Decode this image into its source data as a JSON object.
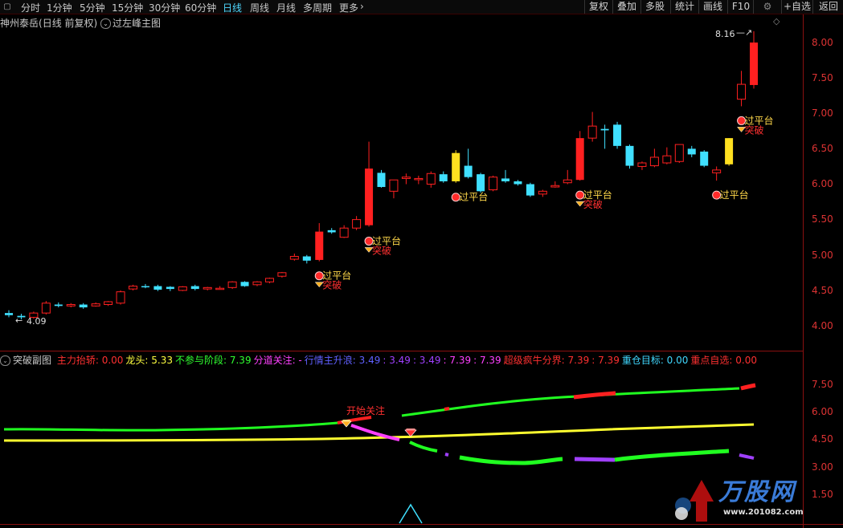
{
  "toolbar": {
    "periods": [
      "分时",
      "1分钟",
      "5分钟",
      "15分钟",
      "30分钟",
      "60分钟",
      "日线",
      "周线",
      "月线",
      "多周期",
      "更多"
    ],
    "active_period": "日线",
    "right_buttons": [
      "复权",
      "叠加",
      "多股",
      "统计",
      "画线",
      "F10",
      "+自选",
      "返回"
    ]
  },
  "main": {
    "stock_name": "神州泰岳",
    "period_info": "(日线 前复权)",
    "indicator": "过左峰主图",
    "high_label": "8.16",
    "low_label": "4.09",
    "y_ticks": [
      "8.00",
      "7.50",
      "7.00",
      "6.50",
      "6.00",
      "5.50",
      "5.00",
      "4.50",
      "4.00"
    ],
    "annotation_platform": "过平台",
    "annotation_break": "突破"
  },
  "sub": {
    "title": "突破副图",
    "legend": [
      {
        "label": "主力抬轿:",
        "value": "0.00",
        "color": "#ff3030"
      },
      {
        "label": "龙头:",
        "value": "5.33",
        "color": "#ffff40"
      },
      {
        "label": "不参与阶段:",
        "value": "7.39",
        "color": "#30ff30"
      },
      {
        "label": "分道关注:",
        "value": "-",
        "color": "#ff40ff"
      },
      {
        "label": "行情主升浪:",
        "value": "3.49",
        "color": "#6060ff"
      },
      {
        "label": ":",
        "value": "3.49",
        "color": "#a040ff"
      },
      {
        "label": ":",
        "value": "3.49",
        "color": "#a040ff"
      },
      {
        "label": ":",
        "value": "7.39",
        "color": "#ff40ff"
      },
      {
        "label": ":",
        "value": "7.39",
        "color": "#ff40ff"
      },
      {
        "label": "超级疯牛分界:",
        "value": "7.39",
        "color": "#ff3030"
      },
      {
        "label": ":",
        "value": "7.39",
        "color": "#ff3030"
      },
      {
        "label": "重仓目标:",
        "value": "0.00",
        "color": "#40d8ff"
      },
      {
        "label": "重点自选:",
        "value": "0.00",
        "color": "#ff3030"
      }
    ],
    "y_ticks": [
      "7.50",
      "6.00",
      "4.50",
      "3.00",
      "1.50"
    ],
    "annotation": "开始关注"
  },
  "watermark": {
    "brand": "万股网",
    "url": "www.201082.com"
  },
  "colors": {
    "up": "#ff2020",
    "down": "#40e0ff",
    "highlight": "#ffe020",
    "grid": "#8a1010"
  },
  "chart_data": {
    "type": "candlestick",
    "ylim": [
      3.85,
      8.3
    ],
    "candles": [
      {
        "o": 4.18,
        "h": 4.22,
        "l": 4.12,
        "c": 4.15
      },
      {
        "o": 4.14,
        "h": 4.17,
        "l": 4.09,
        "c": 4.12
      },
      {
        "o": 4.12,
        "h": 4.2,
        "l": 4.1,
        "c": 4.18
      },
      {
        "o": 4.18,
        "h": 4.35,
        "l": 4.16,
        "c": 4.32
      },
      {
        "o": 4.3,
        "h": 4.33,
        "l": 4.26,
        "c": 4.28
      },
      {
        "o": 4.28,
        "h": 4.32,
        "l": 4.26,
        "c": 4.3
      },
      {
        "o": 4.3,
        "h": 4.32,
        "l": 4.24,
        "c": 4.26
      },
      {
        "o": 4.28,
        "h": 4.33,
        "l": 4.27,
        "c": 4.31
      },
      {
        "o": 4.3,
        "h": 4.35,
        "l": 4.28,
        "c": 4.34
      },
      {
        "o": 4.32,
        "h": 4.5,
        "l": 4.3,
        "c": 4.48
      },
      {
        "o": 4.52,
        "h": 4.58,
        "l": 4.5,
        "c": 4.56
      },
      {
        "o": 4.56,
        "h": 4.59,
        "l": 4.53,
        "c": 4.55
      },
      {
        "o": 4.56,
        "h": 4.58,
        "l": 4.49,
        "c": 4.51
      },
      {
        "o": 4.55,
        "h": 4.56,
        "l": 4.49,
        "c": 4.52
      },
      {
        "o": 4.5,
        "h": 4.56,
        "l": 4.49,
        "c": 4.55
      },
      {
        "o": 4.56,
        "h": 4.58,
        "l": 4.5,
        "c": 4.52
      },
      {
        "o": 4.52,
        "h": 4.55,
        "l": 4.5,
        "c": 4.54
      },
      {
        "o": 4.52,
        "h": 4.56,
        "l": 4.51,
        "c": 4.53
      },
      {
        "o": 4.54,
        "h": 4.63,
        "l": 4.52,
        "c": 4.62
      },
      {
        "o": 4.62,
        "h": 4.63,
        "l": 4.55,
        "c": 4.56
      },
      {
        "o": 4.58,
        "h": 4.63,
        "l": 4.56,
        "c": 4.62
      },
      {
        "o": 4.62,
        "h": 4.68,
        "l": 4.6,
        "c": 4.67
      },
      {
        "o": 4.7,
        "h": 4.76,
        "l": 4.68,
        "c": 4.75
      },
      {
        "o": 4.94,
        "h": 5.02,
        "l": 4.92,
        "c": 4.98
      },
      {
        "o": 4.98,
        "h": 5.0,
        "l": 4.88,
        "c": 4.92
      },
      {
        "o": 4.93,
        "h": 5.45,
        "l": 4.91,
        "c": 5.33
      },
      {
        "o": 5.35,
        "h": 5.38,
        "l": 5.3,
        "c": 5.32
      },
      {
        "o": 5.25,
        "h": 5.42,
        "l": 5.24,
        "c": 5.38
      },
      {
        "o": 5.38,
        "h": 5.55,
        "l": 5.35,
        "c": 5.5
      },
      {
        "o": 5.42,
        "h": 6.6,
        "l": 5.4,
        "c": 6.22
      },
      {
        "o": 6.16,
        "h": 6.2,
        "l": 5.95,
        "c": 5.96
      },
      {
        "o": 5.9,
        "h": 6.05,
        "l": 5.8,
        "c": 6.06
      },
      {
        "o": 6.08,
        "h": 6.15,
        "l": 6.0,
        "c": 6.1
      },
      {
        "o": 6.07,
        "h": 6.12,
        "l": 6.0,
        "c": 6.08
      },
      {
        "o": 6.0,
        "h": 6.18,
        "l": 5.95,
        "c": 6.15
      },
      {
        "o": 6.14,
        "h": 6.18,
        "l": 6.02,
        "c": 6.04
      },
      {
        "o": 6.04,
        "h": 6.48,
        "l": 6.02,
        "c": 6.44
      },
      {
        "o": 6.26,
        "h": 6.5,
        "l": 6.08,
        "c": 6.1
      },
      {
        "o": 6.14,
        "h": 6.16,
        "l": 5.88,
        "c": 5.9
      },
      {
        "o": 5.92,
        "h": 6.12,
        "l": 5.9,
        "c": 6.1
      },
      {
        "o": 6.08,
        "h": 6.2,
        "l": 6.02,
        "c": 6.04
      },
      {
        "o": 6.04,
        "h": 6.06,
        "l": 5.98,
        "c": 6.0
      },
      {
        "o": 6.0,
        "h": 6.02,
        "l": 5.82,
        "c": 5.84
      },
      {
        "o": 5.86,
        "h": 5.92,
        "l": 5.82,
        "c": 5.9
      },
      {
        "o": 5.96,
        "h": 6.04,
        "l": 5.95,
        "c": 5.98
      },
      {
        "o": 6.02,
        "h": 6.2,
        "l": 6.0,
        "c": 6.06
      },
      {
        "o": 6.06,
        "h": 6.75,
        "l": 6.05,
        "c": 6.65
      },
      {
        "o": 6.65,
        "h": 7.02,
        "l": 6.6,
        "c": 6.82
      },
      {
        "o": 6.78,
        "h": 6.84,
        "l": 6.5,
        "c": 6.76
      },
      {
        "o": 6.84,
        "h": 6.88,
        "l": 6.5,
        "c": 6.54
      },
      {
        "o": 6.54,
        "h": 6.56,
        "l": 6.22,
        "c": 6.26
      },
      {
        "o": 6.25,
        "h": 6.32,
        "l": 6.2,
        "c": 6.3
      },
      {
        "o": 6.26,
        "h": 6.5,
        "l": 6.24,
        "c": 6.38
      },
      {
        "o": 6.3,
        "h": 6.52,
        "l": 6.28,
        "c": 6.4
      },
      {
        "o": 6.32,
        "h": 6.56,
        "l": 6.3,
        "c": 6.56
      },
      {
        "o": 6.5,
        "h": 6.54,
        "l": 6.38,
        "c": 6.42
      },
      {
        "o": 6.46,
        "h": 6.48,
        "l": 6.24,
        "c": 6.26
      },
      {
        "o": 6.16,
        "h": 6.25,
        "l": 6.05,
        "c": 6.2
      },
      {
        "o": 6.28,
        "h": 6.65,
        "l": 6.26,
        "c": 6.65
      },
      {
        "o": 7.2,
        "h": 7.6,
        "l": 7.1,
        "c": 7.41
      },
      {
        "o": 7.4,
        "h": 8.16,
        "l": 7.35,
        "c": 8.0
      }
    ],
    "highlight_indices": [
      36,
      58
    ],
    "platform_markers": [
      25,
      29,
      36,
      46,
      57,
      59
    ],
    "break_markers": [
      25,
      29,
      46,
      59
    ]
  }
}
